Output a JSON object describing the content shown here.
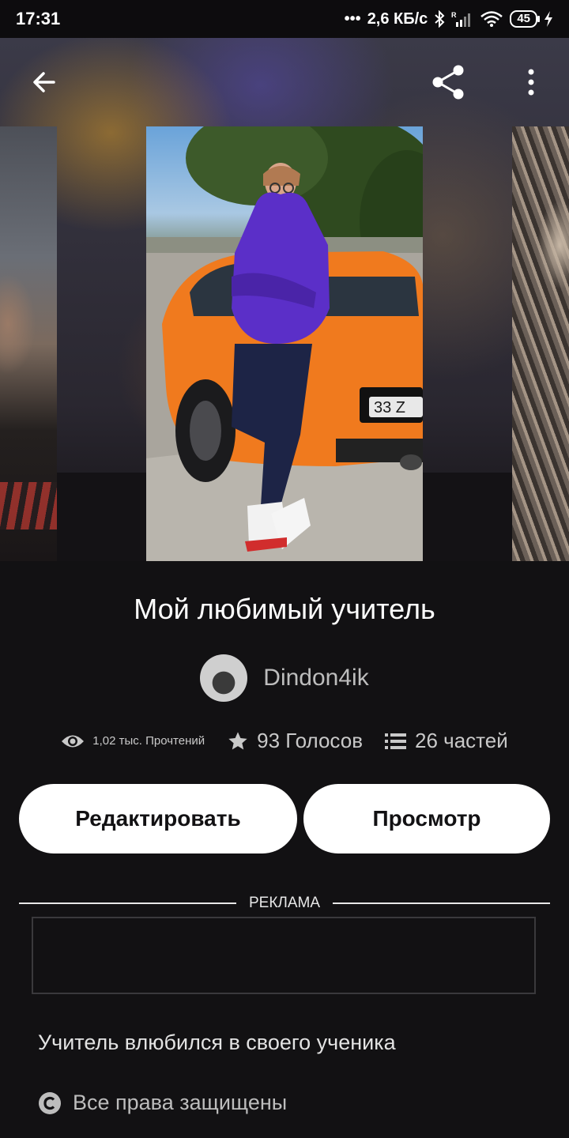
{
  "status_bar": {
    "time": "17:31",
    "network_speed": "2,6 КБ/с",
    "battery": "45",
    "icons": [
      "bluetooth-icon",
      "signal-icon",
      "wifi-icon",
      "battery-icon",
      "charging-icon"
    ]
  },
  "story": {
    "title": "Мой любимый учитель",
    "author": "Dindon4ik",
    "reads": "1,02 тыс. Прочтений",
    "votes": "93 Голосов",
    "parts": "26 частей",
    "description": "Учитель влюбился в своего ученика",
    "copyright": "Все права защищены"
  },
  "buttons": {
    "edit": "Редактировать",
    "view": "Просмотр"
  },
  "ad": {
    "label": "РЕКЛАМА"
  },
  "cover": {
    "plate_text": "33 Z"
  },
  "colors": {
    "background": "#121113",
    "button_bg": "#ffffff",
    "button_text": "#121113",
    "hoodie": "#5b2fc8",
    "car": "#f07a1e"
  }
}
